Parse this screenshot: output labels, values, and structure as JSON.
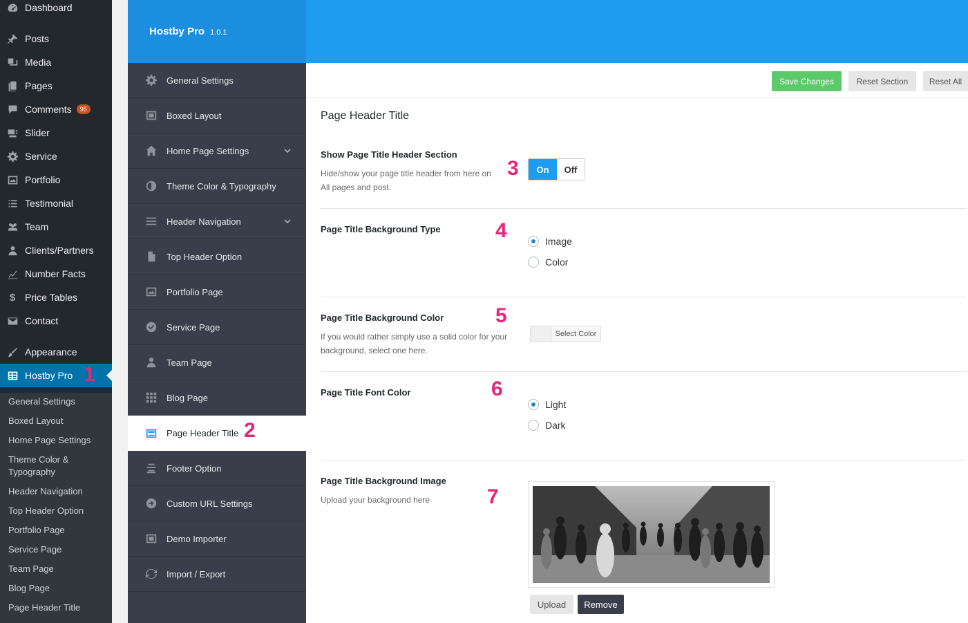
{
  "wp_menu": {
    "items": [
      {
        "label": "Dashboard",
        "icon": "dashboard-icon"
      },
      {
        "label": "Posts",
        "icon": "pin-icon"
      },
      {
        "label": "Media",
        "icon": "media-icon"
      },
      {
        "label": "Pages",
        "icon": "pages-icon"
      },
      {
        "label": "Comments",
        "icon": "comment-icon",
        "badge": "95"
      },
      {
        "label": "Slider",
        "icon": "slider-icon"
      },
      {
        "label": "Service",
        "icon": "gear-icon"
      },
      {
        "label": "Portfolio",
        "icon": "portfolio-icon"
      },
      {
        "label": "Testimonial",
        "icon": "list-icon"
      },
      {
        "label": "Team",
        "icon": "team-icon"
      },
      {
        "label": "Clients/Partners",
        "icon": "user-icon"
      },
      {
        "label": "Number Facts",
        "icon": "chart-icon"
      },
      {
        "label": "Price Tables",
        "icon": "dollar-icon"
      },
      {
        "label": "Contact",
        "icon": "mail-icon"
      },
      {
        "label": "Appearance",
        "icon": "brush-icon"
      },
      {
        "label": "Hostby Pro",
        "icon": "table-icon",
        "active": true
      }
    ],
    "submenu": [
      "General Settings",
      "Boxed Layout",
      "Home Page Settings",
      "Theme Color & Typography",
      "Header Navigation",
      "Top Header Option",
      "Portfolio Page",
      "Service Page",
      "Team Page",
      "Blog Page",
      "Page Header Title"
    ]
  },
  "panel": {
    "brand": "Hostby Pro",
    "version": "1.0.1"
  },
  "options_nav": [
    {
      "label": "General Settings",
      "icon": "gear-icon"
    },
    {
      "label": "Boxed Layout",
      "icon": "box-icon"
    },
    {
      "label": "Home Page Settings",
      "icon": "home-icon",
      "has_children": true
    },
    {
      "label": "Theme Color & Typography",
      "icon": "contrast-icon"
    },
    {
      "label": "Header Navigation",
      "icon": "menu-icon",
      "has_children": true
    },
    {
      "label": "Top Header Option",
      "icon": "document-icon"
    },
    {
      "label": "Portfolio Page",
      "icon": "image-icon"
    },
    {
      "label": "Service Page",
      "icon": "check-icon"
    },
    {
      "label": "Team Page",
      "icon": "user-icon"
    },
    {
      "label": "Blog Page",
      "icon": "grid-icon"
    },
    {
      "label": "Page Header Title",
      "icon": "window-icon",
      "active": true
    },
    {
      "label": "Footer Option",
      "icon": "align-icon"
    },
    {
      "label": "Custom URL Settings",
      "icon": "arrow-circle-icon"
    },
    {
      "label": "Demo Importer",
      "icon": "box-icon"
    },
    {
      "label": "Import / Export",
      "icon": "refresh-icon"
    }
  ],
  "toolbar": {
    "save": "Save Changes",
    "reset_section": "Reset Section",
    "reset_all": "Reset All"
  },
  "section": {
    "title": "Page Header Title",
    "fields": {
      "show_header": {
        "label": "Show Page Title Header Section",
        "desc": "Hide/show your page title header from here on All pages and post.",
        "on": "On",
        "off": "Off",
        "value": "On"
      },
      "bg_type": {
        "label": "Page Title Background Type",
        "options": [
          "Image",
          "Color"
        ],
        "selected": "Image"
      },
      "bg_color": {
        "label": "Page Title Background Color",
        "desc": "If you would rather simply use a solid color for your background, select one here.",
        "button": "Select Color"
      },
      "font_color": {
        "label": "Page Title Font Color",
        "options": [
          "Light",
          "Dark"
        ],
        "selected": "Light"
      },
      "bg_image": {
        "label": "Page Title Background Image",
        "desc": "Upload your background here",
        "upload": "Upload",
        "remove": "Remove"
      }
    }
  },
  "steps": [
    "1",
    "2",
    "3",
    "4",
    "5",
    "6",
    "7"
  ],
  "colors": {
    "accent": "#1e9cf0",
    "wp_active": "#0073aa",
    "save": "#5cc96b",
    "step": "#e3277a",
    "nav_bg": "#393e4a",
    "sidebar_bg": "#23282d"
  }
}
